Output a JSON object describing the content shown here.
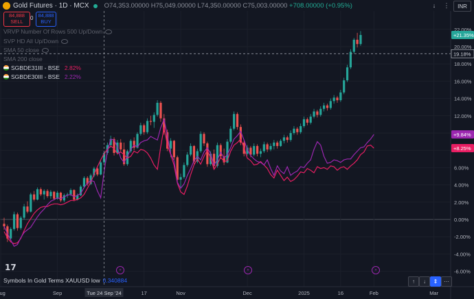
{
  "header": {
    "symbol": "Gold Futures · 1D · MCX",
    "ohlc": {
      "open": "O74,353.00000",
      "high": "H75,049.00000",
      "low": "L74,350.00000",
      "close": "C75,003.00000",
      "change": "+708.00000 (+0.95%)"
    },
    "currency": "INR"
  },
  "trade": {
    "sell_price": "84,888",
    "sell_label": "SELL",
    "spread": "0",
    "buy_price": "84,888",
    "buy_label": "BUY"
  },
  "indicators": [
    "VRVP Number Of Rows 500 Up/Down",
    "SVP HD All Up/Down",
    "SMA 50 close",
    "SMA 200 close"
  ],
  "compare": [
    {
      "name": "SGBDE31III - BSE",
      "value": "2.82%",
      "color": "#e91e63"
    },
    {
      "name": "SGBDE30III - BSE",
      "value": "2.22%",
      "color": "#9c27b0"
    }
  ],
  "bottom_note": {
    "label": "Symbols In Gold Terms XAUUSD low",
    "value": "0.340884"
  },
  "colors": {
    "up": "#26a69a",
    "down": "#ef5350",
    "pink": "#e91e63",
    "purple": "#9c27b0",
    "background": "#131722"
  },
  "chart_data": {
    "type": "candlestick",
    "y_axis": {
      "unit": "%",
      "ylim": [
        -6,
        22
      ],
      "tick_labels": [
        "22.00%",
        "20.00%",
        "18.00%",
        "16.00%",
        "14.00%",
        "12.00%",
        "10.00%",
        "8.00%",
        "6.00%",
        "4.00%",
        "2.00%",
        "0.00%",
        "-2.00%",
        "-4.00%",
        "-6.00%"
      ],
      "tick_values": [
        22,
        20,
        18,
        16,
        14,
        12,
        10,
        8,
        6,
        4,
        2,
        0,
        -2,
        -4,
        -6
      ]
    },
    "x_axis": {
      "tick_labels": [
        {
          "label": "Aug",
          "index": -1
        },
        {
          "label": "Sep",
          "index": 16
        },
        {
          "label": "17",
          "index": 42
        },
        {
          "label": "Nov",
          "index": 53
        },
        {
          "label": "Dec",
          "index": 73
        },
        {
          "label": "2025",
          "index": 90
        },
        {
          "label": "16",
          "index": 101
        },
        {
          "label": "Feb",
          "index": 111
        },
        {
          "label": "Mar",
          "index": 129
        }
      ],
      "crosshair_label": "Tue 24 Sep '24",
      "crosshair_index": 30
    },
    "crosshair_value": "19.18%",
    "price_labels": [
      {
        "text": "+21.35%",
        "value": 21.35,
        "color": "#26a69a"
      },
      {
        "text": "+9.84%",
        "value": 9.84,
        "color": "#9c27b0"
      },
      {
        "text": "+8.25%",
        "value": 8.25,
        "color": "#e91e63"
      }
    ],
    "candles": [
      [
        -0.5,
        0.2,
        -1.2,
        -0.8
      ],
      [
        -0.8,
        -0.6,
        -2.6,
        -2.2
      ],
      [
        -2.2,
        -0.9,
        -2.5,
        -1.1
      ],
      [
        -1.1,
        0.9,
        -1.3,
        0.6
      ],
      [
        0.6,
        0.8,
        -1.3,
        -1.0
      ],
      [
        -1.0,
        0.4,
        -1.2,
        0.2
      ],
      [
        0.2,
        1.8,
        0.0,
        1.5
      ],
      [
        1.5,
        2.1,
        0.7,
        0.9
      ],
      [
        0.9,
        3.1,
        0.8,
        2.9
      ],
      [
        2.9,
        3.3,
        2.1,
        2.3
      ],
      [
        2.3,
        3.7,
        2.2,
        3.5
      ],
      [
        3.5,
        3.7,
        2.7,
        2.9
      ],
      [
        2.9,
        3.5,
        2.3,
        3.3
      ],
      [
        3.3,
        3.5,
        2.5,
        2.7
      ],
      [
        2.7,
        3.4,
        2.4,
        3.2
      ],
      [
        3.2,
        3.3,
        2.2,
        2.4
      ],
      [
        2.4,
        3.3,
        2.3,
        3.1
      ],
      [
        3.1,
        3.2,
        2.0,
        2.2
      ],
      [
        2.2,
        3.0,
        2.0,
        2.8
      ],
      [
        2.8,
        3.1,
        2.5,
        2.9
      ],
      [
        2.9,
        3.6,
        2.7,
        3.4
      ],
      [
        3.4,
        3.5,
        2.1,
        2.3
      ],
      [
        2.3,
        3.0,
        2.2,
        2.8
      ],
      [
        2.8,
        4.0,
        2.7,
        3.8
      ],
      [
        3.8,
        5.0,
        3.6,
        4.8
      ],
      [
        4.8,
        5.0,
        3.9,
        4.1
      ],
      [
        4.1,
        5.3,
        4.0,
        5.1
      ],
      [
        5.1,
        6.1,
        4.9,
        5.9
      ],
      [
        5.9,
        6.0,
        5.0,
        5.2
      ],
      [
        5.2,
        6.8,
        5.1,
        6.6
      ],
      [
        6.6,
        7.9,
        6.4,
        7.7
      ],
      [
        7.7,
        8.9,
        7.5,
        8.6
      ],
      [
        8.6,
        9.7,
        8.3,
        9.3
      ],
      [
        9.3,
        9.5,
        7.4,
        7.7
      ],
      [
        7.7,
        9.2,
        7.5,
        8.9
      ],
      [
        8.9,
        9.3,
        7.8,
        8.1
      ],
      [
        8.1,
        8.9,
        6.2,
        6.4
      ],
      [
        6.4,
        8.1,
        6.2,
        7.9
      ],
      [
        7.9,
        9.3,
        7.7,
        9.1
      ],
      [
        9.1,
        9.5,
        8.0,
        8.3
      ],
      [
        8.3,
        10.1,
        8.2,
        9.9
      ],
      [
        9.9,
        11.2,
        9.7,
        10.9
      ],
      [
        10.9,
        11.1,
        9.8,
        10.1
      ],
      [
        10.1,
        11.7,
        9.9,
        11.4
      ],
      [
        11.4,
        12.0,
        10.9,
        11.3
      ],
      [
        11.3,
        12.4,
        10.6,
        12.1
      ],
      [
        12.1,
        13.8,
        11.9,
        13.5
      ],
      [
        13.5,
        13.7,
        11.3,
        11.7
      ],
      [
        11.7,
        12.2,
        9.8,
        10.1
      ],
      [
        10.1,
        10.4,
        7.9,
        8.2
      ],
      [
        8.2,
        9.4,
        7.2,
        9.1
      ],
      [
        9.1,
        9.2,
        6.9,
        7.2
      ],
      [
        7.2,
        7.4,
        4.3,
        4.6
      ],
      [
        4.6,
        5.3,
        3.6,
        4.9
      ],
      [
        4.9,
        6.6,
        4.7,
        6.3
      ],
      [
        6.3,
        7.8,
        6.1,
        7.5
      ],
      [
        7.5,
        8.8,
        7.3,
        8.5
      ],
      [
        8.5,
        8.6,
        6.4,
        6.7
      ],
      [
        6.7,
        8.2,
        6.5,
        7.9
      ],
      [
        7.9,
        10.2,
        7.7,
        9.9
      ],
      [
        9.9,
        10.1,
        8.5,
        8.8
      ],
      [
        8.8,
        9.0,
        6.1,
        6.4
      ],
      [
        6.4,
        7.9,
        6.2,
        7.6
      ],
      [
        7.6,
        8.1,
        5.9,
        6.2
      ],
      [
        6.2,
        8.9,
        6.0,
        8.6
      ],
      [
        8.6,
        8.8,
        7.0,
        7.3
      ],
      [
        7.3,
        8.2,
        6.3,
        6.6
      ],
      [
        6.6,
        9.3,
        6.5,
        9.0
      ],
      [
        9.0,
        10.8,
        8.8,
        10.5
      ],
      [
        10.5,
        12.5,
        10.3,
        12.2
      ],
      [
        12.2,
        12.4,
        10.4,
        10.7
      ],
      [
        10.7,
        11.0,
        8.6,
        8.9
      ],
      [
        8.9,
        9.1,
        7.3,
        7.6
      ],
      [
        7.6,
        8.6,
        7.4,
        8.3
      ],
      [
        8.3,
        8.5,
        7.2,
        7.5
      ],
      [
        7.5,
        8.8,
        7.3,
        8.5
      ],
      [
        8.5,
        8.7,
        7.3,
        7.6
      ],
      [
        7.6,
        8.2,
        7.2,
        7.9
      ],
      [
        7.9,
        9.0,
        7.7,
        8.7
      ],
      [
        8.7,
        8.9,
        7.8,
        8.1
      ],
      [
        8.1,
        8.8,
        7.9,
        8.5
      ],
      [
        8.5,
        9.2,
        8.1,
        8.9
      ],
      [
        8.9,
        9.1,
        8.2,
        8.5
      ],
      [
        8.5,
        9.3,
        8.4,
        9.1
      ],
      [
        9.1,
        9.8,
        8.8,
        9.5
      ],
      [
        9.5,
        9.7,
        8.9,
        9.2
      ],
      [
        9.2,
        10.3,
        9.0,
        10.0
      ],
      [
        10.0,
        10.8,
        9.8,
        10.5
      ],
      [
        10.5,
        10.7,
        9.8,
        10.1
      ],
      [
        10.1,
        11.1,
        9.9,
        10.8
      ],
      [
        10.8,
        11.9,
        10.6,
        11.6
      ],
      [
        11.6,
        11.8,
        10.9,
        11.2
      ],
      [
        11.2,
        12.2,
        11.0,
        11.9
      ],
      [
        11.9,
        12.8,
        11.7,
        12.5
      ],
      [
        12.5,
        12.7,
        11.8,
        12.1
      ],
      [
        12.1,
        13.1,
        11.9,
        12.8
      ],
      [
        12.8,
        13.5,
        12.5,
        13.2
      ],
      [
        13.2,
        13.4,
        12.6,
        12.9
      ],
      [
        12.9,
        14.0,
        12.7,
        13.7
      ],
      [
        13.7,
        14.4,
        13.4,
        14.1
      ],
      [
        14.1,
        14.3,
        13.5,
        13.8
      ],
      [
        13.8,
        15.0,
        13.6,
        14.7
      ],
      [
        14.7,
        16.4,
        14.5,
        16.1
      ],
      [
        16.1,
        17.9,
        15.9,
        17.6
      ],
      [
        17.6,
        19.7,
        17.4,
        19.4
      ],
      [
        19.4,
        21.0,
        19.2,
        20.8
      ],
      [
        20.8,
        21.6,
        19.9,
        20.3
      ],
      [
        20.3,
        21.8,
        20.1,
        21.35
      ]
    ],
    "series": [
      {
        "name": "SGBDE31III - BSE",
        "color": "#e91e63",
        "values": [
          -1.4,
          -2.1,
          -2.6,
          -2.8,
          -2.7,
          -2.2,
          -1.3,
          -0.5,
          0.1,
          0.7,
          1.1,
          1.4,
          1.5,
          1.5,
          1.7,
          1.8,
          1.8,
          1.7,
          1.8,
          2.0,
          2.2,
          2.2,
          2.3,
          2.5,
          2.9,
          3.6,
          4.3,
          5.2,
          6.1,
          6.9,
          7.6,
          8.1,
          8.5,
          8.2,
          7.6,
          7.8,
          7.5,
          7.1,
          7.3,
          7.9,
          7.7,
          8.1,
          8.0,
          7.7,
          7.1,
          6.3,
          5.8,
          8.4,
          10.7,
          8.6,
          7.5,
          6.3,
          4.2,
          3.2,
          2.9,
          3.9,
          5.2,
          6.3,
          7.0,
          6.4,
          7.3,
          8.0,
          7.1,
          5.8,
          6.4,
          7.2,
          6.7,
          6.8,
          7.9,
          8.6,
          8.9,
          9.3,
          8.3,
          7.1,
          6.8,
          6.3,
          6.4,
          6.7,
          6.3,
          5.9,
          5.2,
          4.8,
          5.7,
          5.1,
          4.5,
          4.9,
          4.4,
          4.6,
          5.0,
          5.5,
          5.4,
          5.9,
          5.7,
          5.4,
          6.1,
          5.9,
          6.0,
          5.8,
          6.2,
          6.1,
          5.7,
          6.0,
          6.1,
          5.8,
          6.2,
          6.5,
          6.9,
          7.5,
          7.8,
          8.5,
          8.6,
          8.25
        ]
      },
      {
        "name": "SGBDE30III - BSE",
        "color": "#9c27b0",
        "values": [
          -0.8,
          -1.6,
          -2.4,
          -3.1,
          -2.9,
          -2.1,
          -1.5,
          -1.2,
          -0.9,
          -0.3,
          0.3,
          0.8,
          1.2,
          1.7,
          2.1,
          2.3,
          2.5,
          2.4,
          2.6,
          2.8,
          2.9,
          2.6,
          2.8,
          3.0,
          3.7,
          4.2,
          4.5,
          4.4,
          3.3,
          2.5,
          5.5,
          7.9,
          9.3,
          9.2,
          8.4,
          7.1,
          6.6,
          7.3,
          8.1,
          8.6,
          8.4,
          8.9,
          9.1,
          9.2,
          9.6,
          9.4,
          9.2,
          10.6,
          11.6,
          9.7,
          7.6,
          6.8,
          4.3,
          3.6,
          4.1,
          5.1,
          5.9,
          6.8,
          7.3,
          6.9,
          7.8,
          8.3,
          7.6,
          6.3,
          6.9,
          7.8,
          7.1,
          7.5,
          8.3,
          9.3,
          9.7,
          10.2,
          9.2,
          8.1,
          7.4,
          7.0,
          6.7,
          6.6,
          6.3,
          6.9,
          5.9,
          5.1,
          6.2,
          5.6,
          5.3,
          6.1,
          5.1,
          5.4,
          5.6,
          6.1,
          6.0,
          6.5,
          6.9,
          8.1,
          9.0,
          8.6,
          7.3,
          6.5,
          6.6,
          6.9,
          6.8,
          6.6,
          6.9,
          7.0,
          7.0,
          7.5,
          7.9,
          8.3,
          8.4,
          8.9,
          9.3,
          9.84
        ]
      }
    ]
  }
}
